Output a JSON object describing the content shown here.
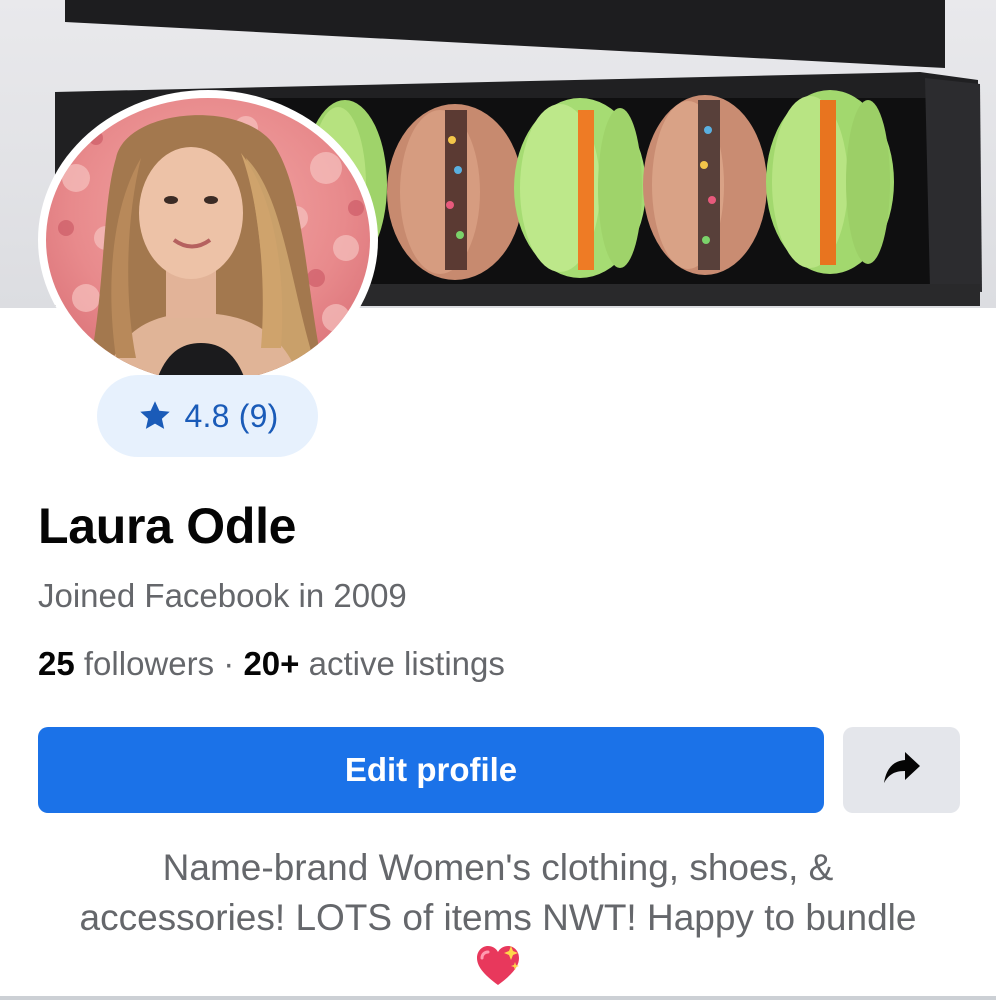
{
  "profile": {
    "name": "Laura Odle",
    "joined": "Joined Facebook in 2009",
    "rating": {
      "score": "4.8",
      "count": "(9)",
      "icon": "star-icon"
    },
    "stats": {
      "followers_count": "25",
      "followers_label": "followers",
      "separator": "·",
      "listings_count": "20+",
      "listings_label": "active listings"
    },
    "bio_text": "Name-brand Women's clothing, shoes, & accessories! LOTS of items NWT! Happy to bundle",
    "bio_emoji": "sparkling-heart-icon"
  },
  "actions": {
    "edit_label": "Edit profile",
    "share_icon": "share-arrow-icon"
  },
  "colors": {
    "primary_button": "#1b72e8",
    "secondary_button": "#e4e6eb",
    "rating_pill_bg": "#e7f1fd",
    "rating_text": "#1a5bb8",
    "secondary_text": "#65676b",
    "primary_text": "#050505"
  }
}
